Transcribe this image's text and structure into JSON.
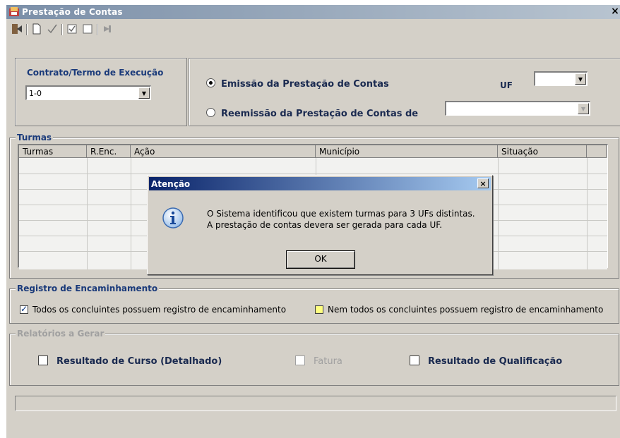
{
  "window": {
    "title": "Prestação de Contas",
    "close_glyph": "×",
    "app_icon": "app-icon"
  },
  "toolbar": {
    "icons": [
      "exit-icon",
      "new-document-icon",
      "check-icon",
      "checked-box-icon",
      "unchecked-box-icon",
      "arrow-icon"
    ]
  },
  "contrato": {
    "label": "Contrato/Termo de Execução",
    "value": "1-0"
  },
  "emissao": {
    "option_emissao": "Emissão da Prestação de Contas",
    "option_reemissao": "Reemissão da Prestação de Contas de",
    "selected": "emissao",
    "uf_label": "UF",
    "uf_value": "",
    "reemissao_value": ""
  },
  "turmas": {
    "label": "Turmas",
    "columns": [
      "Turmas",
      "R.Enc.",
      "Ação",
      "Município",
      "Situação"
    ],
    "rows": []
  },
  "registro": {
    "label": "Registro de Encaminhamento",
    "option_todos": "Todos os concluintes possuem registro de encaminhamento",
    "option_nem_todos": "Nem todos os concluintes possuem registro de encaminhamento",
    "todos_checked": true,
    "colors": {
      "nem_todos_box": "#ffff80"
    }
  },
  "relatorios": {
    "label": "Relatórios a Gerar",
    "option_resultado_curso": "Resultado de Curso (Detalhado)",
    "option_fatura": "Fatura",
    "option_resultado_qualificacao": "Resultado de Qualificação"
  },
  "dialog": {
    "title": "Atenção",
    "close_glyph": "×",
    "message_line1": "O Sistema identificou que existem turmas para 3 UFs distintas.",
    "message_line2": "A prestação de contas devera ser gerada para cada UF.",
    "ok_label": "OK",
    "icon": "info-icon"
  },
  "colors": {
    "window_bg": "#d4d0c8",
    "dialog_title_start": "#0a246a",
    "dialog_title_end": "#a6caf0",
    "label_blue": "#1a3a7a"
  }
}
